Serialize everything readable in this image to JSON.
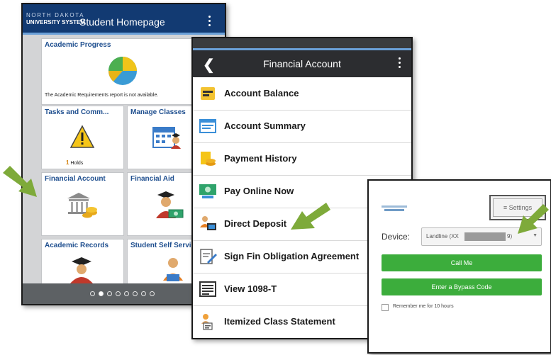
{
  "colors": {
    "accent_blue": "#1f4f8f",
    "header_navy": "#123a72",
    "header_dark": "#2c2d30",
    "green_button": "#3cad3c",
    "arrow_green": "#7eaa3a"
  },
  "homepage": {
    "logo_line1": "NORTH DAKOTA",
    "logo_line2": "UNIVERSITY SYSTEM",
    "title": "Student Homepage",
    "tiles": {
      "academic_progress": {
        "title": "Academic Progress",
        "note": "The Academic Requirements report is not available."
      },
      "tasks": {
        "title": "Tasks and Comm...",
        "holds_count": "1",
        "holds_label": "Holds"
      },
      "manage_classes": {
        "title": "Manage Classes"
      },
      "financial_account": {
        "title": "Financial Account"
      },
      "financial_aid": {
        "title": "Financial Aid"
      },
      "academic_records": {
        "title": "Academic Records"
      },
      "self_service": {
        "title": "Student Self Servi"
      }
    },
    "page_dots": {
      "total": 8,
      "active": 2
    }
  },
  "financial_account": {
    "title": "Financial Account",
    "menu": [
      {
        "label": "Account Balance",
        "icon": "account-balance-icon"
      },
      {
        "label": "Account Summary",
        "icon": "account-summary-icon"
      },
      {
        "label": "Payment History",
        "icon": "payment-history-icon"
      },
      {
        "label": "Pay Online Now",
        "icon": "pay-online-icon"
      },
      {
        "label": "Direct Deposit",
        "icon": "direct-deposit-icon"
      },
      {
        "label": "Sign Fin Obligation Agreement",
        "icon": "sign-agreement-icon"
      },
      {
        "label": "View 1098-T",
        "icon": "form-1098t-icon"
      },
      {
        "label": "Itemized Class Statement",
        "icon": "itemized-statement-icon"
      }
    ]
  },
  "auth": {
    "settings_label": "≡ Settings",
    "device_label": "Device:",
    "device_value_prefix": "Landline (XX",
    "device_value_suffix": "9)",
    "call_button": "Call Me",
    "bypass_button": "Enter a Bypass Code",
    "remember_label": "Remember me for 10 hours"
  }
}
